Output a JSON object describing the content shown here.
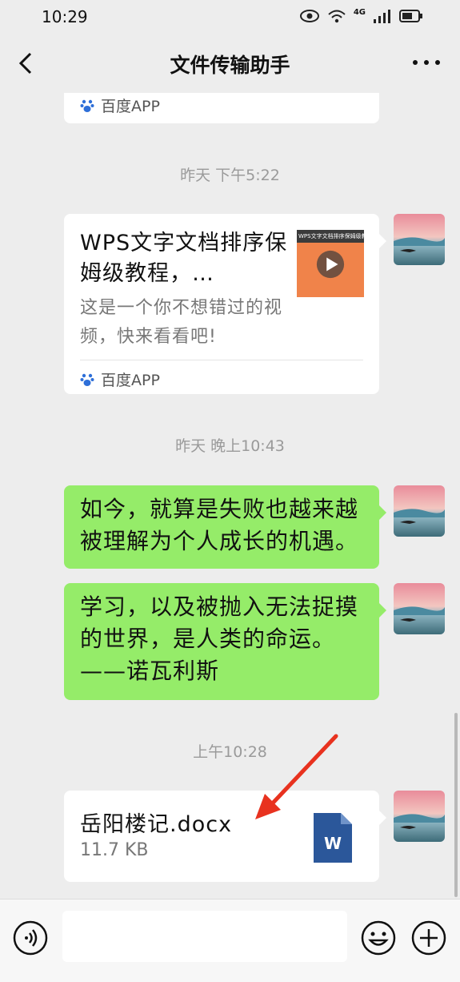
{
  "status": {
    "time": "10:29",
    "network": "4G"
  },
  "header": {
    "title": "文件传输助手"
  },
  "messages": {
    "prev_card_source": "百度APP",
    "ts1": "昨天 下午5:22",
    "video_card": {
      "title": "WPS文字文档排序保姆级教程，…",
      "desc": "这是一个你不想错过的视频，快来看看吧!",
      "thumb_header": "WPS文字文档排序保姆级教程",
      "source": "百度APP"
    },
    "ts2": "昨天 晚上10:43",
    "bubble1": "如今，就算是失败也越来越被理解为个人成长的机遇。",
    "bubble2_line1": "学习，以及被抛入无法捉摸",
    "bubble2_line2": "的世界，是人类的命运。",
    "bubble2_line3": "——诺瓦利斯",
    "ts3": "上午10:28",
    "file": {
      "name": "岳阳楼记.docx",
      "size": "11.7 KB",
      "icon_letter": "W"
    }
  },
  "icons": {
    "back": "chevron-left-icon",
    "more": "more-dots-icon",
    "voice": "voice-icon",
    "emoji": "emoji-icon",
    "plus": "plus-icon",
    "paw": "baidu-paw-icon",
    "file": "word-doc-icon"
  },
  "colors": {
    "bubble": "#95ec69",
    "background": "#ededed",
    "word_blue": "#2b579a",
    "arrow": "#e8321f"
  }
}
